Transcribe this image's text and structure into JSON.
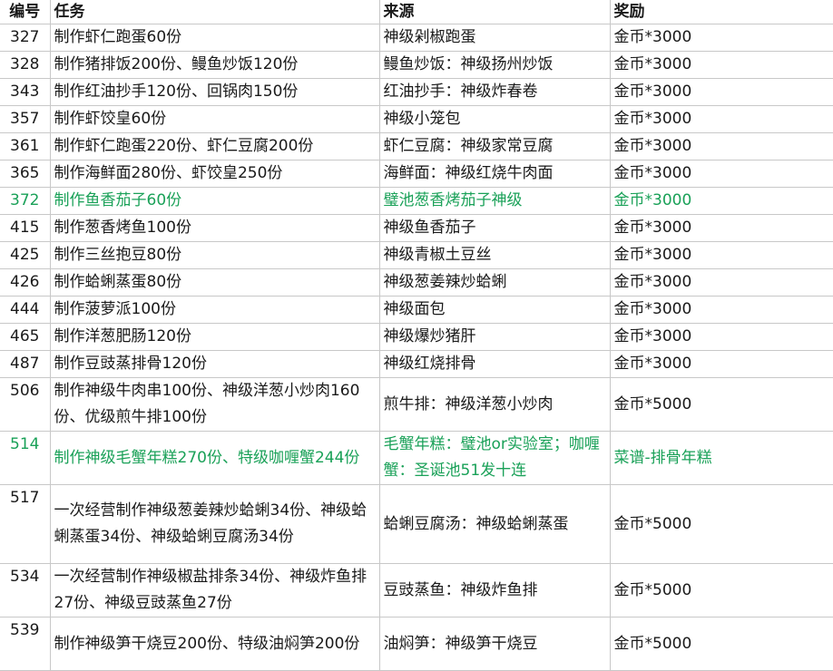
{
  "headers": {
    "id": "编号",
    "task": "任务",
    "source": "来源",
    "reward": "奖励"
  },
  "colors": {
    "highlight": "#1aa158",
    "grid": "#c8c8c8",
    "text": "#1a1a1a"
  },
  "rows": [
    {
      "id": "327",
      "task": "制作虾仁跑蛋60份",
      "source": "神级剁椒跑蛋",
      "reward": "金币*3000"
    },
    {
      "id": "328",
      "task": "制作猪排饭200份、鳗鱼炒饭120份",
      "source": "鳗鱼炒饭：神级扬州炒饭",
      "reward": "金币*3000"
    },
    {
      "id": "343",
      "task": "制作红油抄手120份、回锅肉150份",
      "source": "红油抄手：神级炸春卷",
      "reward": "金币*3000"
    },
    {
      "id": "357",
      "task": "制作虾饺皇60份",
      "source": "神级小笼包",
      "reward": "金币*3000"
    },
    {
      "id": "361",
      "task": "制作虾仁跑蛋220份、虾仁豆腐200份",
      "source": "虾仁豆腐：神级家常豆腐",
      "reward": "金币*3000"
    },
    {
      "id": "365",
      "task": "制作海鲜面280份、虾饺皇250份",
      "source": "海鲜面：神级红烧牛肉面",
      "reward": "金币*3000"
    },
    {
      "id": "372",
      "task": "制作鱼香茄子60份",
      "source": "璧池葱香烤茄子神级",
      "reward": "金币*3000"
    },
    {
      "id": "415",
      "task": "制作葱香烤鱼100份",
      "source": "神级鱼香茄子",
      "reward": "金币*3000"
    },
    {
      "id": "425",
      "task": "制作三丝抱豆80份",
      "source": "神级青椒土豆丝",
      "reward": "金币*3000"
    },
    {
      "id": "426",
      "task": "制作蛤蜊蒸蛋80份",
      "source": "神级葱姜辣炒蛤蜊",
      "reward": "金币*3000"
    },
    {
      "id": "444",
      "task": "制作菠萝派100份",
      "source": "神级面包",
      "reward": "金币*3000"
    },
    {
      "id": "465",
      "task": "制作洋葱肥肠120份",
      "source": "神级爆炒猪肝",
      "reward": "金币*3000"
    },
    {
      "id": "487",
      "task": "制作豆豉蒸排骨120份",
      "source": "神级红烧排骨",
      "reward": "金币*3000"
    },
    {
      "id": "506",
      "task": "制作神级牛肉串100份、神级洋葱小炒肉160份、优级煎牛排100份",
      "source": "煎牛排：神级洋葱小炒肉",
      "reward": "金币*5000"
    },
    {
      "id": "514",
      "task": "制作神级毛蟹年糕270份、特级咖喱蟹244份",
      "source": "毛蟹年糕：璧池or实验室；咖喱蟹：圣诞池51发十连",
      "reward": "菜谱-排骨年糕"
    },
    {
      "id": "517",
      "task": "一次经营制作神级葱姜辣炒蛤蜊34份、神级蛤蜊蒸蛋34份、神级蛤蜊豆腐汤34份",
      "source": "蛤蜊豆腐汤：神级蛤蜊蒸蛋",
      "reward": "金币*5000"
    },
    {
      "id": "534",
      "task": "一次经营制作神级椒盐排条34份、神级炸鱼排27份、神级豆豉蒸鱼27份",
      "source": "豆豉蒸鱼：神级炸鱼排",
      "reward": "金币*5000"
    },
    {
      "id": "539",
      "task": "制作神级笋干烧豆200份、特级油焖笋200份",
      "source": "油焖笋：神级笋干烧豆",
      "reward": "金币*5000"
    }
  ]
}
